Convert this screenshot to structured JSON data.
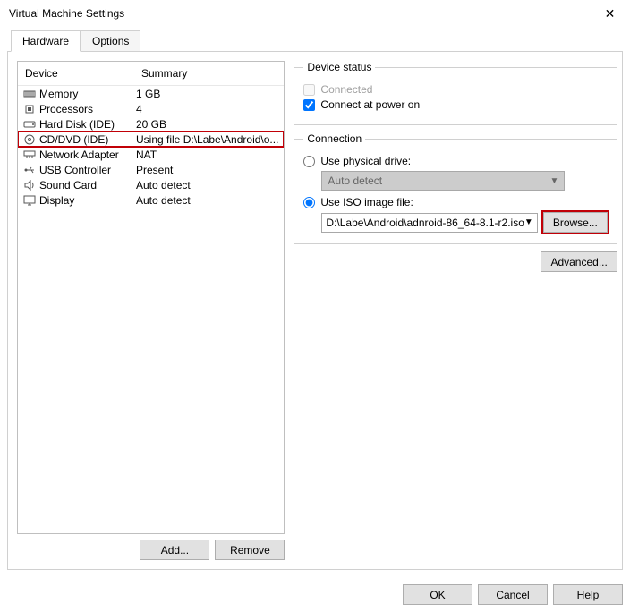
{
  "window": {
    "title": "Virtual Machine Settings"
  },
  "tabs": {
    "hardware": "Hardware",
    "options": "Options"
  },
  "list": {
    "header_device": "Device",
    "header_summary": "Summary",
    "rows": [
      {
        "device": "Memory",
        "summary": "1 GB"
      },
      {
        "device": "Processors",
        "summary": "4"
      },
      {
        "device": "Hard Disk (IDE)",
        "summary": "20 GB"
      },
      {
        "device": "CD/DVD (IDE)",
        "summary": "Using file D:\\Labe\\Android\\o..."
      },
      {
        "device": "Network Adapter",
        "summary": "NAT"
      },
      {
        "device": "USB Controller",
        "summary": "Present"
      },
      {
        "device": "Sound Card",
        "summary": "Auto detect"
      },
      {
        "device": "Display",
        "summary": "Auto detect"
      }
    ]
  },
  "left_buttons": {
    "add": "Add...",
    "remove": "Remove"
  },
  "status_group": {
    "legend": "Device status",
    "connected": "Connected",
    "power_on": "Connect at power on"
  },
  "conn_group": {
    "legend": "Connection",
    "physical": "Use physical drive:",
    "auto_detect": "Auto detect",
    "use_iso": "Use ISO image file:",
    "iso_path": "D:\\Labe\\Android\\adnroid-86_64-8.1-r2.iso",
    "browse": "Browse..."
  },
  "advanced": "Advanced...",
  "footer": {
    "ok": "OK",
    "cancel": "Cancel",
    "help": "Help"
  }
}
